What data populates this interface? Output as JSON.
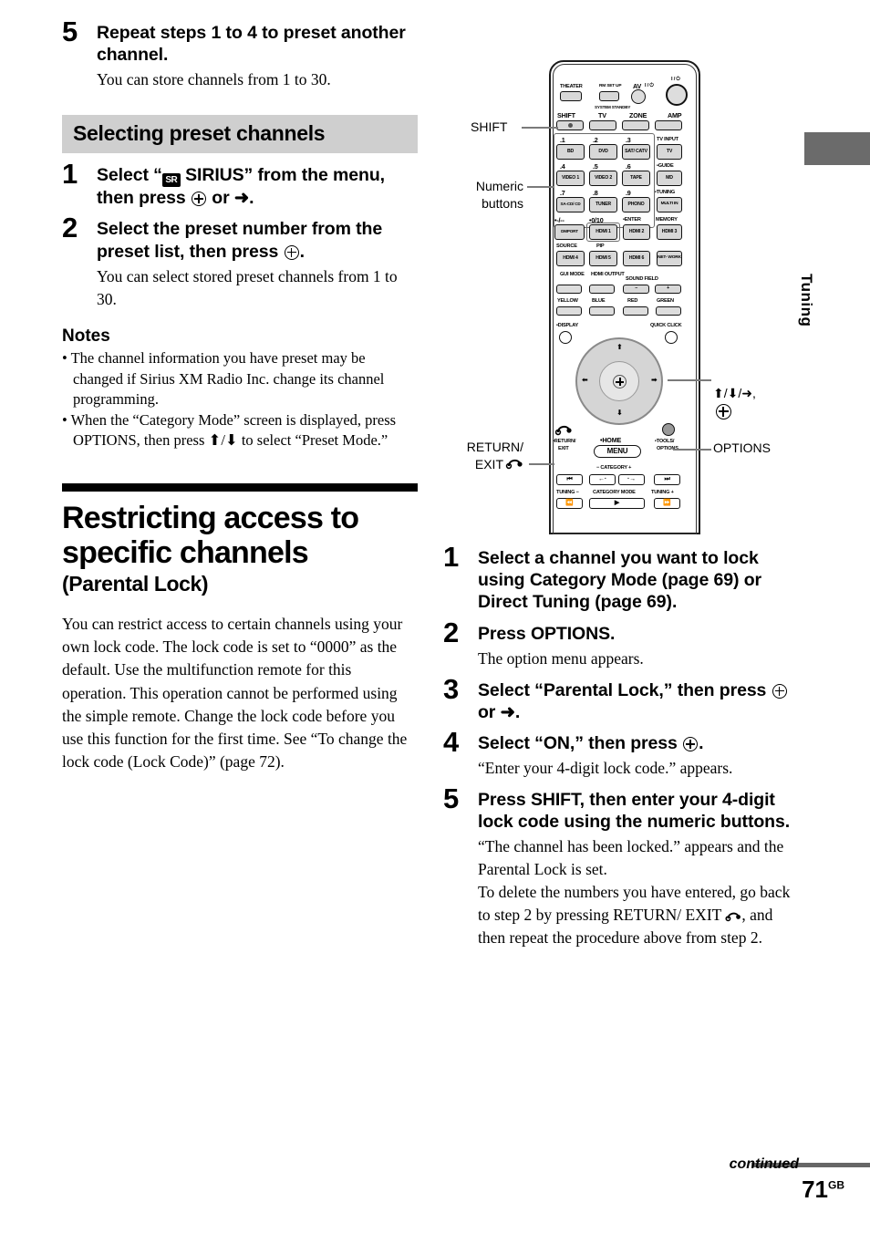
{
  "left_column": {
    "step5": {
      "num": "5",
      "title": "Repeat steps 1 to 4 to preset another channel.",
      "desc": "You can store channels from 1 to 30."
    },
    "gray_heading": "Selecting preset channels",
    "step1": {
      "num": "1",
      "title_a": "Select “",
      "sirius_badge": "SR",
      "title_b": " SIRIUS” from the menu, then press ",
      "title_c": " or ➜."
    },
    "step2": {
      "num": "2",
      "title_a": "Select the preset number from the preset list, then press ",
      "title_b": ".",
      "desc": "You can select stored preset channels from 1 to 30."
    },
    "notes_title": "Notes",
    "notes": [
      "• The channel information you have preset may be changed if Sirius XM Radio Inc. change its channel programming.",
      "• When the “Category Mode” screen is displayed, press OPTIONS, then press ⬆/⬇ to select “Preset Mode.”"
    ],
    "section_title": "Restricting access to specific channels",
    "section_subtitle": "(Parental Lock)",
    "section_body": "You can restrict access to certain channels using your own lock code. The lock code is set to “0000” as the default. Use the multifunction remote for this operation. This operation cannot be performed using the simple remote. Change the lock code before you use this function for the first time. See “To change the lock code (Lock Code)” (page 72)."
  },
  "right_column": {
    "step1": {
      "num": "1",
      "title": "Select a channel you want to lock using Category Mode (page 69) or Direct Tuning (page 69)."
    },
    "step2": {
      "num": "2",
      "title": "Press OPTIONS.",
      "desc": "The option menu appears."
    },
    "step3": {
      "num": "3",
      "title_a": "Select “Parental Lock,” then press ",
      "title_b": " or ➜."
    },
    "step4": {
      "num": "4",
      "title_a": "Select “ON,” then press ",
      "title_b": ".",
      "desc": "“Enter your 4-digit lock code.” appears."
    },
    "step5": {
      "num": "5",
      "title": "Press SHIFT, then enter your 4-digit lock code using the numeric buttons.",
      "desc_a": "“The channel has been locked.” appears and the Parental Lock is set.",
      "desc_b1": "To delete the numbers you have entered, go back to step 2 by pressing RETURN/ EXIT ",
      "desc_b2": ", and then repeat the procedure above from step 2."
    }
  },
  "callouts": {
    "shift": "SHIFT",
    "numeric": "Numeric\nbuttons",
    "numeric_line1": "Numeric",
    "numeric_line2": "buttons",
    "return_line1": "RETURN/",
    "return_line2": "EXIT",
    "arrows_line1": "⬆/⬇/➜,",
    "options": "OPTIONS"
  },
  "remote": {
    "top_labels": {
      "theater": "THEATER",
      "rm_set_up": "RM SET UP",
      "av": "AV",
      "av_power": "I / ⏻",
      "main_power": "I / ⏻",
      "system_standby": "SYSTEM STANDBY"
    },
    "mode_row": [
      "SHIFT",
      "TV",
      "ZONE",
      "AMP"
    ],
    "numeric_grid": [
      {
        "num": ".1",
        "label": "BD"
      },
      {
        "num": ".2",
        "label": "DVD"
      },
      {
        "num": ".3",
        "label": "SAT/ CATV"
      },
      {
        "num": ".4",
        "label": "VIDEO 1"
      },
      {
        "num": ".5",
        "label": "VIDEO 2"
      },
      {
        "num": ".6",
        "label": "TAPE"
      },
      {
        "num": ".7",
        "label": "SA-CD/ CD"
      },
      {
        "num": ".8",
        "label": "TUNER"
      },
      {
        "num": ".9",
        "label": "PHONO"
      }
    ],
    "right_col_buttons": [
      {
        "num": "TV INPUT",
        "label": "TV"
      },
      {
        "num": "•GUIDE",
        "label": "MD"
      },
      {
        "num": "•TUNING",
        "label": "MULTI IN"
      }
    ],
    "row_enter": [
      {
        "num": "•-/--",
        "label": "DMPORT"
      },
      {
        "num": "•0/10",
        "label": "HDMI 1"
      },
      {
        "num": "•ENTER",
        "label": "HDMI 2"
      },
      {
        "num": "MEMORY",
        "label": "HDMI 3"
      }
    ],
    "row_source": [
      {
        "num": "SOURCE",
        "label": "HDMI 4"
      },
      {
        "num": "PIP",
        "label": "HDMI 5"
      },
      {
        "num": "",
        "label": "HDMI 6"
      },
      {
        "num": "",
        "label": "NET- WORK"
      }
    ],
    "row_gui": [
      {
        "num": "GUI MODE",
        "label": ""
      },
      {
        "num": "HDMI OUTPUT",
        "label": ""
      },
      {
        "num": "SOUND FIELD",
        "label": "−"
      },
      {
        "num": "",
        "label": "+"
      }
    ],
    "row_color": [
      {
        "num": "YELLOW",
        "label": ""
      },
      {
        "num": "BLUE",
        "label": ""
      },
      {
        "num": "RED",
        "label": ""
      },
      {
        "num": "GREEN",
        "label": ""
      }
    ],
    "display_label": "•DISPLAY",
    "quick_click_label": "QUICK CLICK",
    "home_label": "•HOME",
    "menu_label": "MENU",
    "return_exit_label": "•RETURN/ EXIT",
    "tools_options_label": "•TOOLS/ OPTIONS",
    "category_label": "− CATEGORY +",
    "transport": [
      "⏮",
      "←·",
      "·→",
      "⏭"
    ],
    "bottom_labels": [
      "TUNING −",
      "CATEGORY MODE",
      "TUNING +"
    ]
  },
  "side_tab": {
    "label": "Tuning"
  },
  "footer": {
    "continued": "continued",
    "page": "71",
    "page_sup": "GB"
  },
  "colors": {
    "gray_heading_bg": "#cfcfcf",
    "black_rule": "#000000",
    "side_tab": "#6b6b6b",
    "leader_line": "#7a7a7a",
    "button_face": "#d8d8d8"
  }
}
